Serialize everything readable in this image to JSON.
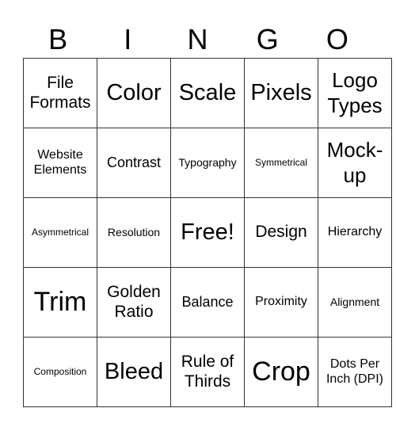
{
  "header": [
    "B",
    "I",
    "N",
    "G",
    "O"
  ],
  "rows": [
    [
      "File Formats",
      "Color",
      "Scale",
      "Pixels",
      "Logo Types"
    ],
    [
      "Website Elements",
      "Contrast",
      "Typography",
      "Symmetrical",
      "Mock-up"
    ],
    [
      "Asymmetrical",
      "Resolution",
      "Free!",
      "Design",
      "Hierarchy"
    ],
    [
      "Trim",
      "Golden Ratio",
      "Balance",
      "Proximity",
      "Alignment"
    ],
    [
      "Composition",
      "Bleed",
      "Rule of Thirds",
      "Crop",
      "Dots Per Inch (DPI)"
    ]
  ]
}
